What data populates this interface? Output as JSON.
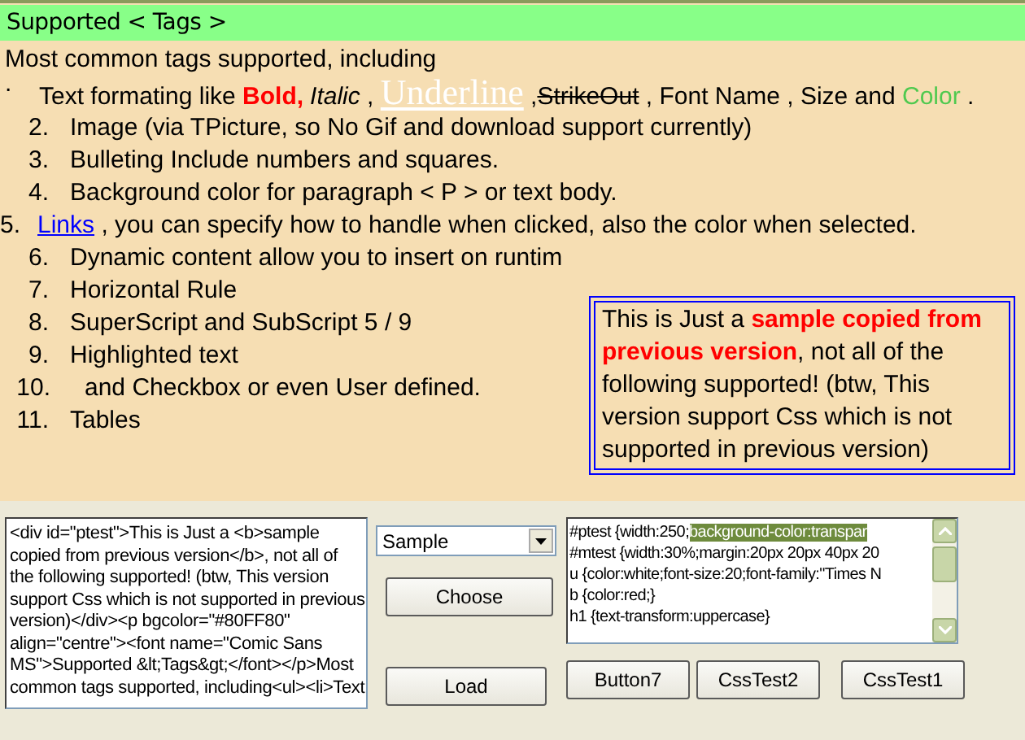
{
  "viewer": {
    "header": "Supported < Tags >",
    "intro": "Most common tags supported, including",
    "items": [
      {
        "kind": "outdent",
        "marker": ".",
        "segments": [
          {
            "kind": "plain",
            "text": "Text formating like "
          },
          {
            "kind": "bold",
            "text": "Bold,"
          },
          {
            "kind": "italic",
            "text": "Italic"
          },
          {
            "kind": "plain",
            "text": " , "
          },
          {
            "kind": "underline",
            "text": "Underline"
          },
          {
            "kind": "plain",
            "text": " ,"
          },
          {
            "kind": "strike",
            "text": "StrikeOut"
          },
          {
            "kind": "plain",
            "text": " , Font Name , Size   and "
          },
          {
            "kind": "color",
            "text": "Color",
            "color": "#4fc94f"
          },
          {
            "kind": "plain",
            "text": " ."
          }
        ]
      },
      {
        "kind": "numbered",
        "marker": "2.",
        "segments": [
          {
            "kind": "plain",
            "text": "Image (via TPicture, so No Gif and download support currently)"
          }
        ]
      },
      {
        "kind": "numbered",
        "marker": "3.",
        "segments": [
          {
            "kind": "plain",
            "text": "Bulleting Include numbers and squares."
          }
        ]
      },
      {
        "kind": "numbered",
        "marker": "4.",
        "segments": [
          {
            "kind": "plain",
            "text": "Background color for paragraph   < P >   or text body."
          }
        ]
      },
      {
        "kind": "cut",
        "marker": "5.",
        "segments": [
          {
            "kind": "link",
            "text": "Links"
          },
          {
            "kind": "plain",
            "text": " , you can specify how to handle when clicked, also the color when selected."
          }
        ]
      },
      {
        "kind": "numbered",
        "marker": "6.",
        "segments": [
          {
            "kind": "plain",
            "text": "Dynamic content allow you to insert on runtim"
          }
        ]
      },
      {
        "kind": "numbered",
        "marker": "7.",
        "segments": [
          {
            "kind": "plain",
            "text": "Horizontal Rule"
          }
        ]
      },
      {
        "kind": "numbered",
        "marker": "8.",
        "segments": [
          {
            "kind": "plain",
            "text": "SuperScript and SubScript  5 / 9"
          }
        ]
      },
      {
        "kind": "numbered",
        "marker": "9.",
        "segments": [
          {
            "kind": "plain",
            "text": "Highlighted   text"
          }
        ]
      },
      {
        "kind": "indent",
        "marker": "10.",
        "segments": [
          {
            "kind": "plain",
            "text": "and Checkbox or even  User defined."
          }
        ]
      },
      {
        "kind": "numbered",
        "marker": "11.",
        "segments": [
          {
            "kind": "plain",
            "text": "Tables"
          }
        ]
      }
    ],
    "note": "This is Just a **sample copied from previous version**, not all of the following supported! (btw, This version support Css which is not supported in previous version)"
  },
  "html_editor": {
    "lines": [
      "<div id=\"ptest\">This is Just a <b>sample",
      "copied from previous version</b>, not all of",
      "the following supported! (btw, This version",
      "support Css which is not supported in previous",
      "version)</div><p bgcolor=\"#80FF80\"",
      "align=\"centre\"><font name=\"Comic Sans",
      "MS\">Supported &lt;Tags&gt;</font></p>Most",
      "common tags supported, including<ul><li>Text"
    ]
  },
  "sample_select": {
    "value": "Sample"
  },
  "buttons": {
    "choose": "Choose",
    "load": "Load",
    "row": [
      "Button7",
      "CssTest2",
      "CssTest1"
    ]
  },
  "css_editor": {
    "lines": [
      {
        "text": "#ptest {width:250;",
        "selection": "background-color:transpar"
      },
      {
        "text": "#mtest {width:30%;margin:20px 20px 40px 20"
      },
      {
        "text": "u {color:white;font-size:20;font-family:\"Times N"
      },
      {
        "text": "b {color:red;}"
      },
      {
        "text": "h1 {text-transform:uppercase}"
      }
    ]
  }
}
